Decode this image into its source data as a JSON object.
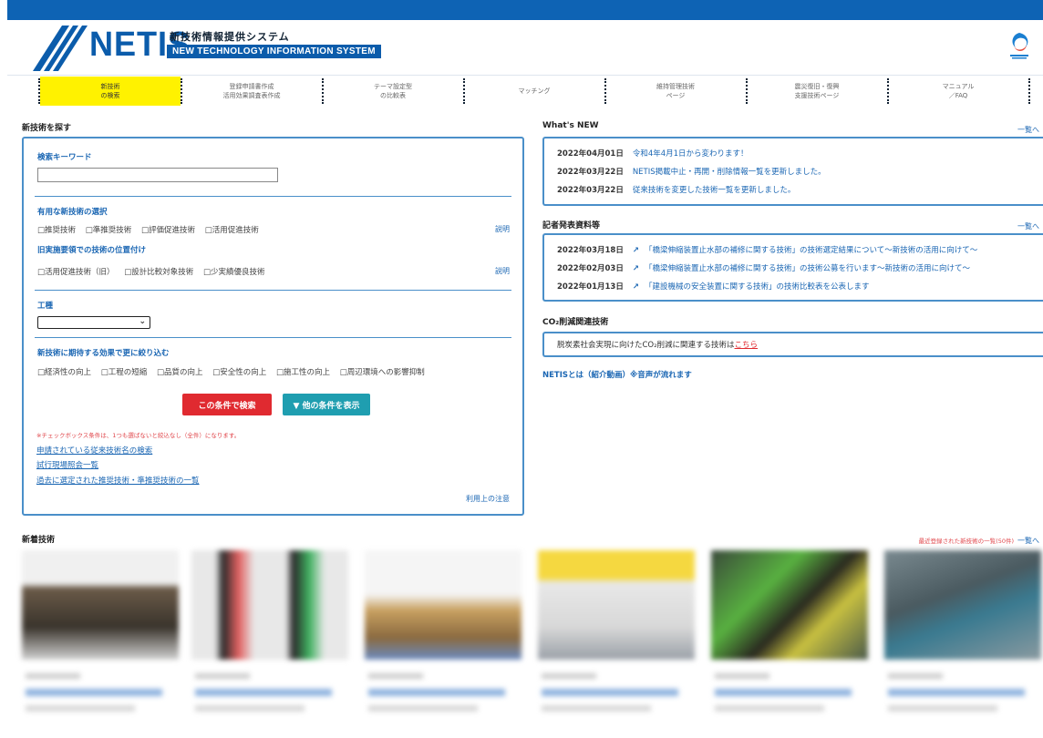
{
  "header": {
    "logo_text": "NETIS",
    "logo_jp": "新技術情報提供システム",
    "logo_en": "NEW TECHNOLOGY INFORMATION SYSTEM"
  },
  "nav": [
    {
      "label": "新技術\nの検索",
      "active": true
    },
    {
      "label": "登録申請書作成\n活用効果調査表作成",
      "active": false
    },
    {
      "label": "テーマ設定型\nの比較表",
      "active": false
    },
    {
      "label": "マッチング",
      "active": false
    },
    {
      "label": "維持管理技術\nページ",
      "active": false
    },
    {
      "label": "震災復旧・復興\n支援技術ページ",
      "active": false
    },
    {
      "label": "マニュアル\n／FAQ",
      "active": false
    }
  ],
  "search": {
    "section_title": "新技術を探す",
    "keyword_label": "検索キーワード",
    "keyword_value": "",
    "useful_label": "有用な新技術の選択",
    "useful_options": [
      "□推奨技術",
      "□準推奨技術",
      "□評価促進技術",
      "□活用促進技術"
    ],
    "old_label": "旧実施要領での技術の位置付け",
    "old_options": [
      "□活用促進技術（旧）",
      "□設計比較対象技術",
      "□少実績優良技術"
    ],
    "explain": "説明",
    "kouji_label": "工種",
    "effect_label": "新技術に期待する効果で更に絞り込む",
    "effect_options": [
      "□経済性の向上",
      "□工程の短縮",
      "□品質の向上",
      "□安全性の向上",
      "□施工性の向上",
      "□周辺環境への影響抑制"
    ],
    "search_button": "この条件で検索",
    "other_button": "▼ 他の条件を表示",
    "note": "※チェックボックス条件は、1つも選ばないと絞込なし（全件）になります。",
    "links": [
      "申請されている従来技術名の検索",
      "試行現場照会一覧",
      "過去に選定された推奨技術・準推奨技術の一覧"
    ],
    "usage_note": "利用上の注意"
  },
  "whats_new": {
    "title": "What's NEW",
    "more": "一覧へ",
    "items": [
      {
        "date": "2022年04月01日",
        "text": "令和4年4月1日から変わります！"
      },
      {
        "date": "2022年03月22日",
        "text": "NETIS掲載中止・再開・削除情報一覧を更新しました。"
      },
      {
        "date": "2022年03月22日",
        "text": "従来技術を変更した技術一覧を更新しました。"
      }
    ]
  },
  "press": {
    "title": "記者発表資料等",
    "more": "一覧へ",
    "items": [
      {
        "date": "2022年03月18日",
        "text": "「橋梁伸縮装置止水部の補修に関する技術」の技術選定結果について～新技術の活用に向けて～"
      },
      {
        "date": "2022年02月03日",
        "text": "「橋梁伸縮装置止水部の補修に関する技術」の技術公募を行います～新技術の活用に向けて～"
      },
      {
        "date": "2022年01月13日",
        "text": "「建設機械の安全装置に関する技術」の技術比較表を公表します"
      }
    ]
  },
  "co2": {
    "title": "CO₂削減関連技術",
    "text": "脱炭素社会実現に向けたCO₂削減に関連する技術は",
    "link": "こちら"
  },
  "netis_video": "NETISとは（紹介動画）※音声が流れます",
  "new_tech": {
    "title": "新着技術",
    "recent": "最近登録された新技術の一覧(50件)",
    "more": "一覧へ"
  },
  "colors": {
    "brand_blue": "#0e63b4",
    "link_blue": "#1a66b3",
    "search_red": "#e02a30",
    "teal": "#1f9eb0",
    "active_yellow": "#fff200"
  }
}
